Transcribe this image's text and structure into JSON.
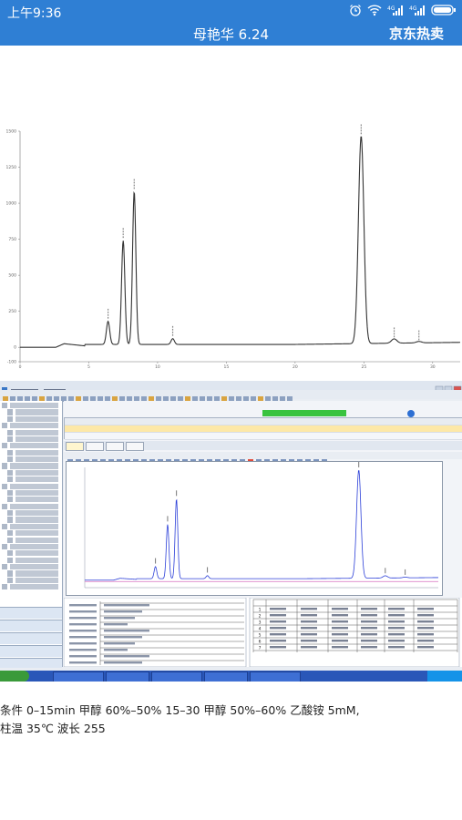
{
  "status_bar": {
    "time": "上午9:36",
    "icons": [
      "alarm-icon",
      "wifi-icon",
      "signal-icon",
      "signal-icon",
      "battery-icon"
    ]
  },
  "header": {
    "title": "母艳华 6.24",
    "action": "京东热卖"
  },
  "caption": {
    "line1": "条件 0–15min  甲醇 60%–50% 15–30  甲醇 50%–60%  乙酸铵 5mM,",
    "line2": "柱温 35℃  波长 255"
  },
  "chart_data": [
    {
      "type": "line",
      "title": "",
      "xlabel": "",
      "ylabel": "",
      "xlim": [
        0,
        32
      ],
      "ylim": [
        -100,
        1500
      ],
      "x_ticks": [
        0,
        5,
        10,
        15,
        20,
        25,
        30
      ],
      "y_ticks": [
        "-100",
        "0",
        "250",
        "500",
        "750",
        "1000",
        "1250",
        "1500"
      ],
      "peaks": [
        {
          "x": 6.4,
          "y": 160
        },
        {
          "x": 7.5,
          "y": 720
        },
        {
          "x": 8.3,
          "y": 1060
        },
        {
          "x": 11.1,
          "y": 40
        },
        {
          "x": 24.8,
          "y": 1440
        },
        {
          "x": 27.2,
          "y": 30
        },
        {
          "x": 29.0,
          "y": 10
        }
      ]
    }
  ],
  "software": {
    "menu": [
      "文件(F)",
      "视图(V)",
      "数据(D)",
      "工具(T)",
      "帮助(H)"
    ],
    "table_rows": [
      "1",
      "2",
      "3",
      "4",
      "5",
      "6",
      "7"
    ]
  }
}
